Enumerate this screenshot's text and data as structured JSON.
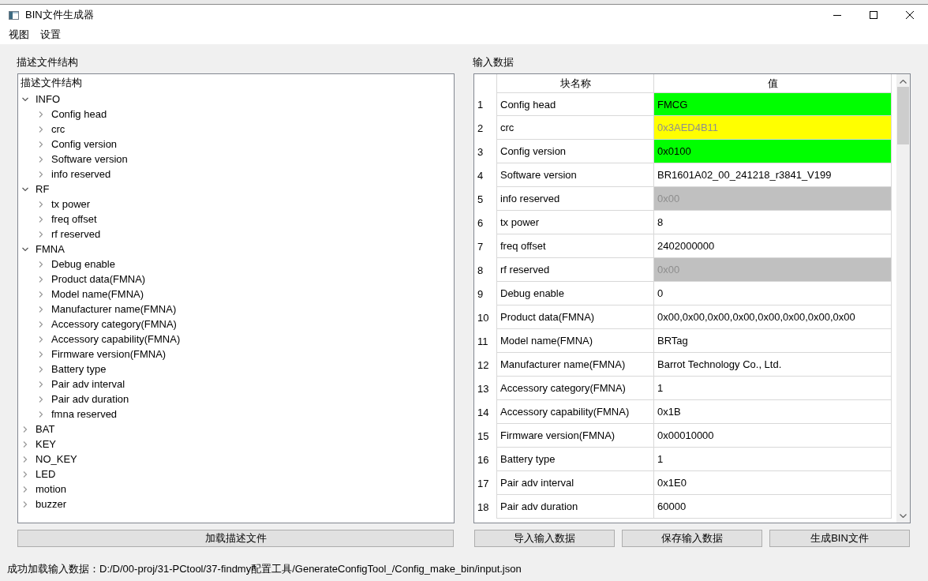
{
  "window": {
    "title": "BIN文件生成器"
  },
  "menu": [
    "视图",
    "设置"
  ],
  "tree_panel": {
    "label": "描述文件结构",
    "header": "描述文件结构",
    "items": [
      {
        "label": "INFO",
        "expanded": true,
        "children": [
          {
            "label": "Config head",
            "expanded": false
          },
          {
            "label": "crc",
            "expanded": false
          },
          {
            "label": "Config version",
            "expanded": false
          },
          {
            "label": "Software version",
            "expanded": false
          },
          {
            "label": "info reserved",
            "expanded": false
          }
        ]
      },
      {
        "label": "RF",
        "expanded": true,
        "children": [
          {
            "label": "tx power",
            "expanded": false
          },
          {
            "label": "freq offset",
            "expanded": false
          },
          {
            "label": "rf reserved",
            "expanded": false
          }
        ]
      },
      {
        "label": "FMNA",
        "expanded": true,
        "children": [
          {
            "label": "Debug enable",
            "expanded": false
          },
          {
            "label": "Product data(FMNA)",
            "expanded": false
          },
          {
            "label": "Model name(FMNA)",
            "expanded": false
          },
          {
            "label": "Manufacturer name(FMNA)",
            "expanded": false
          },
          {
            "label": "Accessory category(FMNA)",
            "expanded": false
          },
          {
            "label": "Accessory capability(FMNA)",
            "expanded": false
          },
          {
            "label": "Firmware version(FMNA)",
            "expanded": false
          },
          {
            "label": "Battery type",
            "expanded": false
          },
          {
            "label": "Pair adv interval",
            "expanded": false
          },
          {
            "label": "Pair adv duration",
            "expanded": false
          },
          {
            "label": "fmna reserved",
            "expanded": false
          }
        ]
      },
      {
        "label": "BAT",
        "expanded": false
      },
      {
        "label": "KEY",
        "expanded": false
      },
      {
        "label": "NO_KEY",
        "expanded": false
      },
      {
        "label": "LED",
        "expanded": false
      },
      {
        "label": "motion",
        "expanded": false
      },
      {
        "label": "buzzer",
        "expanded": false
      }
    ],
    "button": "加载描述文件"
  },
  "data_panel": {
    "label": "输入数据",
    "columns": [
      "块名称",
      "值"
    ],
    "rows": [
      {
        "index": "1",
        "name": "Config head",
        "value": "FMCG",
        "color": "#00ff00",
        "disabled": false
      },
      {
        "index": "2",
        "name": "crc",
        "value": "0x3AED4B11",
        "color": "#ffff00",
        "disabled": true
      },
      {
        "index": "3",
        "name": "Config version",
        "value": "0x0100",
        "color": "#00ff00",
        "disabled": false
      },
      {
        "index": "4",
        "name": "Software version",
        "value": "BR1601A02_00_241218_r3841_V199",
        "disabled": false
      },
      {
        "index": "5",
        "name": "info reserved",
        "value": "0x00",
        "color": "#c0c0c0",
        "disabled": true
      },
      {
        "index": "6",
        "name": "tx power",
        "value": "8",
        "disabled": false
      },
      {
        "index": "7",
        "name": "freq offset",
        "value": "2402000000",
        "disabled": false
      },
      {
        "index": "8",
        "name": "rf reserved",
        "value": "0x00",
        "color": "#c0c0c0",
        "disabled": true
      },
      {
        "index": "9",
        "name": "Debug enable",
        "value": "0",
        "disabled": false
      },
      {
        "index": "10",
        "name": "Product data(FMNA)",
        "value": "0x00,0x00,0x00,0x00,0x00,0x00,0x00,0x00",
        "disabled": false
      },
      {
        "index": "11",
        "name": "Model name(FMNA)",
        "value": "BRTag",
        "disabled": false
      },
      {
        "index": "12",
        "name": "Manufacturer name(FMNA)",
        "value": "Barrot Technology Co., Ltd.",
        "disabled": false
      },
      {
        "index": "13",
        "name": "Accessory category(FMNA)",
        "value": "1",
        "disabled": false
      },
      {
        "index": "14",
        "name": "Accessory capability(FMNA)",
        "value": "0x1B",
        "disabled": false
      },
      {
        "index": "15",
        "name": "Firmware version(FMNA)",
        "value": "0x00010000",
        "disabled": false
      },
      {
        "index": "16",
        "name": "Battery type",
        "value": "1",
        "disabled": false
      },
      {
        "index": "17",
        "name": "Pair adv interval",
        "value": "0x1E0",
        "disabled": false
      },
      {
        "index": "18",
        "name": "Pair adv duration",
        "value": "60000",
        "disabled": false
      }
    ],
    "buttons": [
      "导入输入数据",
      "保存输入数据",
      "生成BIN文件"
    ]
  },
  "status_bar": {
    "text": "成功加载输入数据：D:/D/00-proj/31-PCtool/37-findmy配置工具/GenerateConfigTool_/Config_make_bin/input.json"
  }
}
